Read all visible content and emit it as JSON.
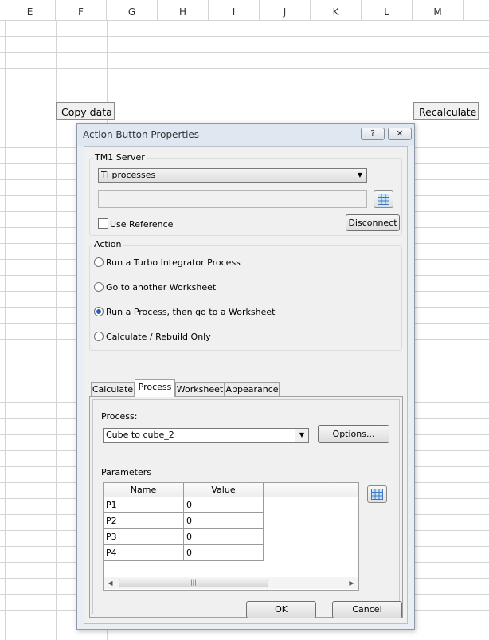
{
  "spreadsheet": {
    "columns": [
      "E",
      "F",
      "G",
      "H",
      "I",
      "J",
      "K",
      "L",
      "M"
    ],
    "copy_button": "Copy data",
    "recalc_button": "Recalculate"
  },
  "dialog": {
    "title": "Action Button Properties",
    "help_glyph": "?",
    "close_glyph": "✕",
    "tm1_server": {
      "label": "TM1 Server",
      "selected": "TI processes",
      "reference_value": "",
      "use_reference_label": "Use Reference",
      "use_reference_checked": false,
      "disconnect_label": "Disconnect"
    },
    "action": {
      "label": "Action",
      "options": [
        "Run a Turbo Integrator Process",
        "Go to another Worksheet",
        "Run a Process, then go to a Worksheet",
        "Calculate / Rebuild Only"
      ],
      "selected_index": 2
    },
    "tabs": [
      "Calculate",
      "Process",
      "Worksheet",
      "Appearance"
    ],
    "active_tab": "Process",
    "process": {
      "label": "Process:",
      "selected": "Cube to cube_2",
      "options_button": "Options...",
      "parameters_label": "Parameters",
      "columns": [
        "Name",
        "Value"
      ],
      "rows": [
        {
          "name": "P1",
          "value": "0"
        },
        {
          "name": "P2",
          "value": "0"
        },
        {
          "name": "P3",
          "value": "0"
        },
        {
          "name": "P4",
          "value": "0"
        }
      ]
    },
    "ok_label": "OK",
    "cancel_label": "Cancel"
  },
  "colors": {
    "accent": "#2b5db8",
    "dialog_bg": "#f0f0f0",
    "frame": "#e9eef5"
  },
  "icons": [
    "help-icon",
    "close-icon",
    "dropdown-arrow-icon",
    "grid-picker-icon",
    "scroll-left-icon",
    "scroll-right-icon"
  ]
}
